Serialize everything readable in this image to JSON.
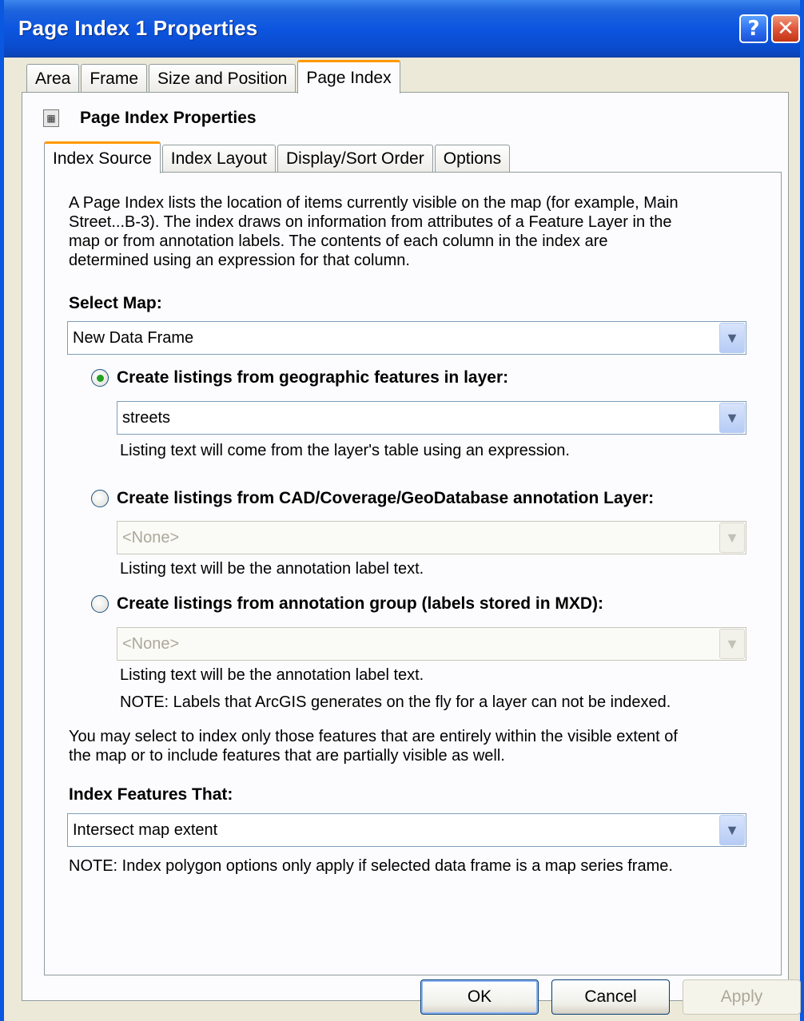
{
  "window": {
    "title": "Page Index 1 Properties",
    "help_glyph": "?",
    "close_glyph": "✕"
  },
  "top_tabs": [
    "Area",
    "Frame",
    "Size and Position",
    "Page Index"
  ],
  "section": {
    "icon_glyph": "▦",
    "title": "Page Index Properties"
  },
  "inner_tabs": [
    "Index Source",
    "Index Layout",
    "Display/Sort Order",
    "Options"
  ],
  "intro": [
    "A Page Index lists the location of items currently visible on the map (for example, Main",
    "Street...B-3).  The index draws on information from attributes of a Feature Layer in the",
    "map or from annotation labels.  The contents of each column in the index are",
    "determined using an expression for that column."
  ],
  "select_map": {
    "label": "Select Map:",
    "value": "New Data Frame"
  },
  "option1": {
    "label": "Create listings from geographic features in layer:",
    "checked": true,
    "combo_value": "streets",
    "hint": "Listing text will come from the layer's table using an expression."
  },
  "option2": {
    "label": "Create listings from CAD/Coverage/GeoDatabase annotation Layer:",
    "checked": false,
    "combo_value": "<None>",
    "hint": "Listing text will be the annotation label text."
  },
  "option3": {
    "label": "Create listings from annotation group (labels stored in MXD):",
    "checked": false,
    "combo_value": "<None>",
    "hint": "Listing text will be the annotation label text.",
    "note": "NOTE: Labels that ArcGIS generates on the fly for a layer can not be indexed."
  },
  "extent_text": [
    "You may select to index only those features that are entirely within the visible extent of",
    "the map or to include features that are partially visible as well."
  ],
  "index_features": {
    "label": "Index Features That:",
    "value": "Intersect map extent",
    "note": "NOTE: Index polygon options only apply if selected data frame is a map series frame."
  },
  "dropdown_glyph": "▼",
  "buttons": {
    "ok": "OK",
    "cancel": "Cancel",
    "apply": "Apply"
  }
}
